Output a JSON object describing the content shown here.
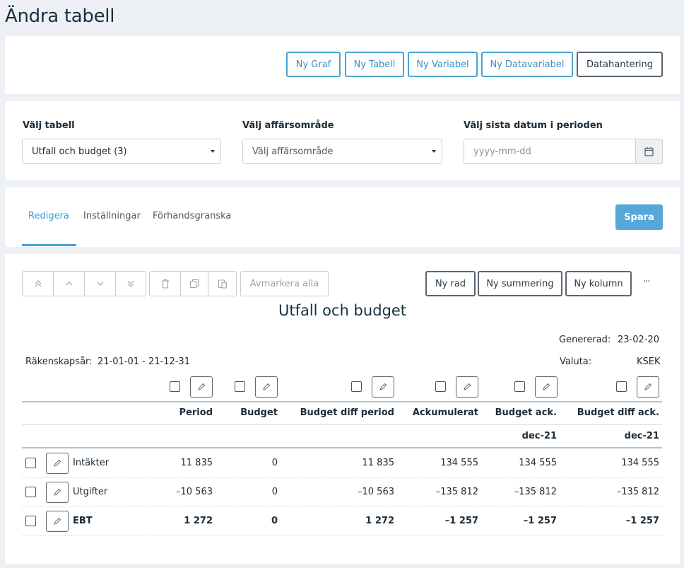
{
  "page_title": "Ändra tabell",
  "actions": {
    "ny_graf": "Ny Graf",
    "ny_tabell": "Ny Tabell",
    "ny_variabel": "Ny Variabel",
    "ny_datavariabel": "Ny Datavariabel",
    "datahantering": "Datahantering"
  },
  "filters": {
    "table_label": "Välj tabell",
    "table_value": "Utfall och budget (3)",
    "area_label": "Välj affärsområde",
    "area_placeholder": "Välj affärsområde",
    "date_label": "Välj sista datum i perioden",
    "date_placeholder": "yyyy-mm-dd"
  },
  "tabs": {
    "redigera": "Redigera",
    "installningar": "Inställningar",
    "forhandsgranska": "Förhandsgranska",
    "save": "Spara"
  },
  "toolbar": {
    "deselect_all": "Avmarkera alla",
    "new_row": "Ny rad",
    "new_summary": "Ny summering",
    "new_column": "Ny kolumn",
    "more": "···"
  },
  "report": {
    "title": "Utfall och budget",
    "generated_label": "Genererad:",
    "generated_value": "23-02-20",
    "fiscal_year_label": "Räkenskapsår:",
    "fiscal_year_value": "21-01-01 - 21-12-31",
    "currency_label": "Valuta:",
    "currency_value": "KSEK",
    "columns": [
      "Period",
      "Budget",
      "Budget diff period",
      "Ackumulerat",
      "Budget ack.",
      "Budget diff ack."
    ],
    "subheaders": [
      "",
      "",
      "",
      "",
      "dec-21",
      "dec-21"
    ],
    "rows": [
      {
        "label": "Intäkter",
        "values": [
          "11 835",
          "0",
          "11 835",
          "134 555",
          "134 555",
          "134 555"
        ]
      },
      {
        "label": "Utgifter",
        "values": [
          "–10 563",
          "0",
          "–10 563",
          "–135 812",
          "–135 812",
          "–135 812"
        ]
      },
      {
        "label": "EBT",
        "values": [
          "1 272",
          "0",
          "1 272",
          "–1 257",
          "–1 257",
          "–1 257"
        ]
      }
    ]
  },
  "icons": {
    "calendar": "calendar-icon",
    "pencil": "pencil-icon",
    "trash": "trash-icon",
    "copy": "copy-icon",
    "paste": "paste-icon"
  },
  "colors": {
    "accent": "#4aa3d4",
    "primary_button": "#56a8da",
    "background": "#edf1f5"
  }
}
